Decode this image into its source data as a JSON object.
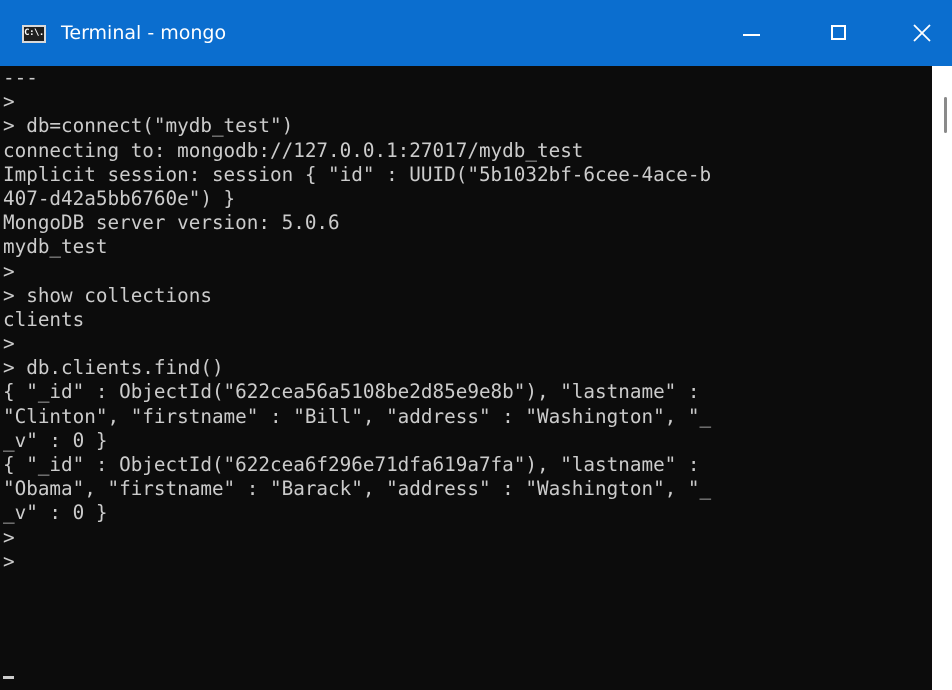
{
  "window": {
    "icon_text": "C:\\.",
    "title": "Terminal - mongo"
  },
  "colors": {
    "titlebar": "#0b6ecf",
    "terminal_bg": "#0c0c0c",
    "terminal_text": "#cccccc"
  },
  "icons": {
    "minimize": "minimize-icon",
    "maximize": "maximize-icon",
    "close": "close-icon"
  },
  "terminal": {
    "lines": [
      "---",
      ">",
      "> db=connect(\"mydb_test\")",
      "connecting to: mongodb://127.0.0.1:27017/mydb_test",
      "Implicit session: session { \"id\" : UUID(\"5b1032bf-6cee-4ace-b",
      "407-d42a5bb6760e\") }",
      "MongoDB server version: 5.0.6",
      "mydb_test",
      ">",
      "> show collections",
      "clients",
      ">",
      "> db.clients.find()",
      "{ \"_id\" : ObjectId(\"622cea56a5108be2d85e9e8b\"), \"lastname\" :",
      "\"Clinton\", \"firstname\" : \"Bill\", \"address\" : \"Washington\", \"_",
      "_v\" : 0 }",
      "{ \"_id\" : ObjectId(\"622cea6f296e71dfa619a7fa\"), \"lastname\" :",
      "\"Obama\", \"firstname\" : \"Barack\", \"address\" : \"Washington\", \"_",
      "_v\" : 0 }",
      ">",
      ">"
    ]
  }
}
